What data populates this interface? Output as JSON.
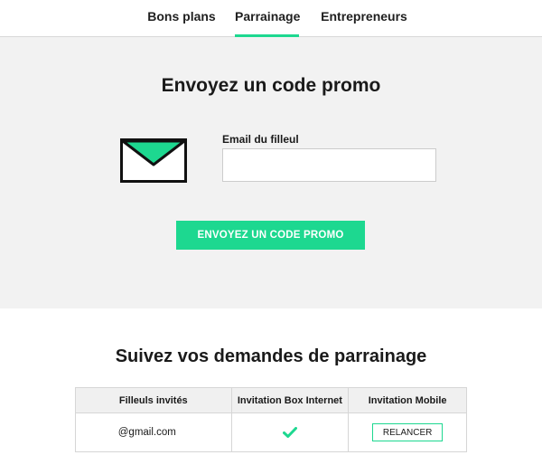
{
  "tabs": [
    {
      "label": "Bons plans",
      "active": false
    },
    {
      "label": "Parrainage",
      "active": true
    },
    {
      "label": "Entrepreneurs",
      "active": false
    }
  ],
  "promo": {
    "title": "Envoyez un code promo",
    "icon": "envelope-icon",
    "email_label": "Email du filleul",
    "email_value": "",
    "email_placeholder": "",
    "button_label": "ENVOYEZ UN CODE PROMO"
  },
  "tracking": {
    "title": "Suivez vos demandes de parrainage",
    "columns": [
      "Filleuls invités",
      "Invitation Box Internet",
      "Invitation Mobile"
    ],
    "rows": [
      {
        "email": "@gmail.com",
        "box_internet_status": "check-icon",
        "mobile_action": "RELANCER"
      }
    ]
  },
  "colors": {
    "accent": "#1dd890",
    "section_background": "#f2f2f2",
    "header_background": "#f0f0f0"
  }
}
